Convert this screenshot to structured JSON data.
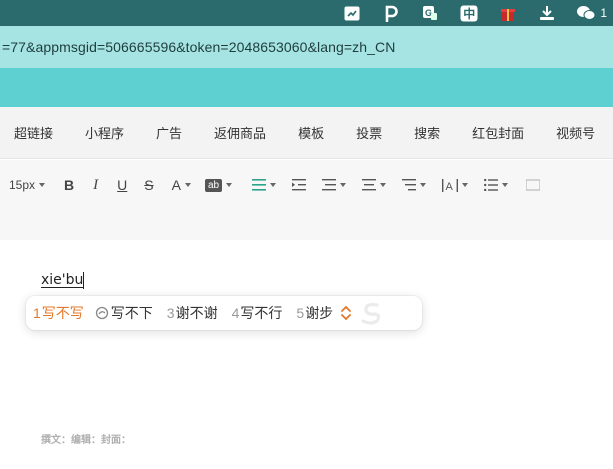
{
  "menubar": {
    "icons": [
      "dock-app-icon",
      "p-app-icon",
      "translate-icon",
      "input-method-zhong-icon",
      "gift-icon",
      "download-icon",
      "wechat-icon"
    ],
    "input_method_char": "中",
    "wechat_count": "1"
  },
  "browser": {
    "url": "=77&appmsgid=506665596&token=2048653060&lang=zh_CN"
  },
  "insert_toolbar": {
    "items": [
      "超链接",
      "小程序",
      "广告",
      "返佣商品",
      "模板",
      "投票",
      "搜索",
      "红包封面",
      "视频号"
    ]
  },
  "format_toolbar": {
    "font_size": "15px",
    "bold": "B",
    "italic": "I",
    "underline": "U",
    "strike": "S",
    "font_color": "A",
    "bg_color": "ab"
  },
  "editor": {
    "typed_text": "xie'bu",
    "meta_text": "撰文：编辑：封面："
  },
  "ime": {
    "candidates": [
      {
        "num": "1",
        "word": "写不写"
      },
      {
        "num": "",
        "word": "写不下"
      },
      {
        "num": "3",
        "word": "谢不谢"
      },
      {
        "num": "4",
        "word": "写不行"
      },
      {
        "num": "5",
        "word": "谢步"
      }
    ],
    "accent_color": "#e2782b"
  }
}
